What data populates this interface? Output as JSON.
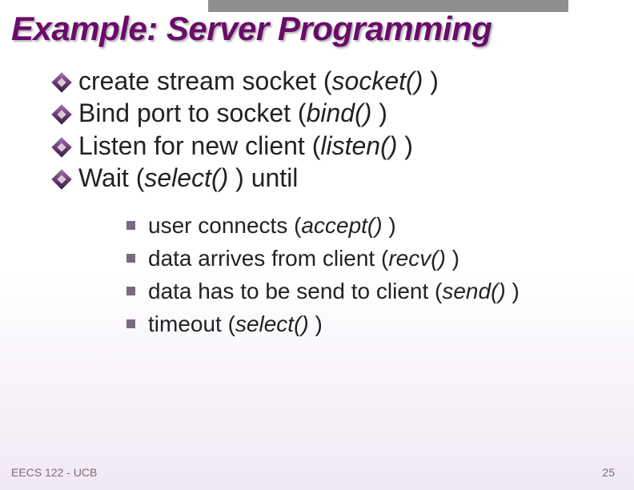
{
  "title": "Example: Server Programming",
  "bullets": [
    {
      "pre": "create stream socket (",
      "func": "socket()",
      "post": " )"
    },
    {
      "pre": "Bind port to socket (",
      "func": "bind()",
      "post": " )"
    },
    {
      "pre": "Listen for new client (",
      "func": "listen()",
      "post": " )"
    },
    {
      "pre": "Wait (",
      "func": "select()",
      "post": " ) until"
    }
  ],
  "subbullets": [
    {
      "pre": "user connects (",
      "func": "accept()",
      "post": " )"
    },
    {
      "pre": "data arrives from client (",
      "func": "recv()",
      "post": " )"
    },
    {
      "pre": "data has to be send to client (",
      "func": "send()",
      "post": " )"
    },
    {
      "pre": "timeout (",
      "func": "select()",
      "post": " )"
    }
  ],
  "footer": {
    "left": "EECS 122 - UCB",
    "right": "25"
  }
}
